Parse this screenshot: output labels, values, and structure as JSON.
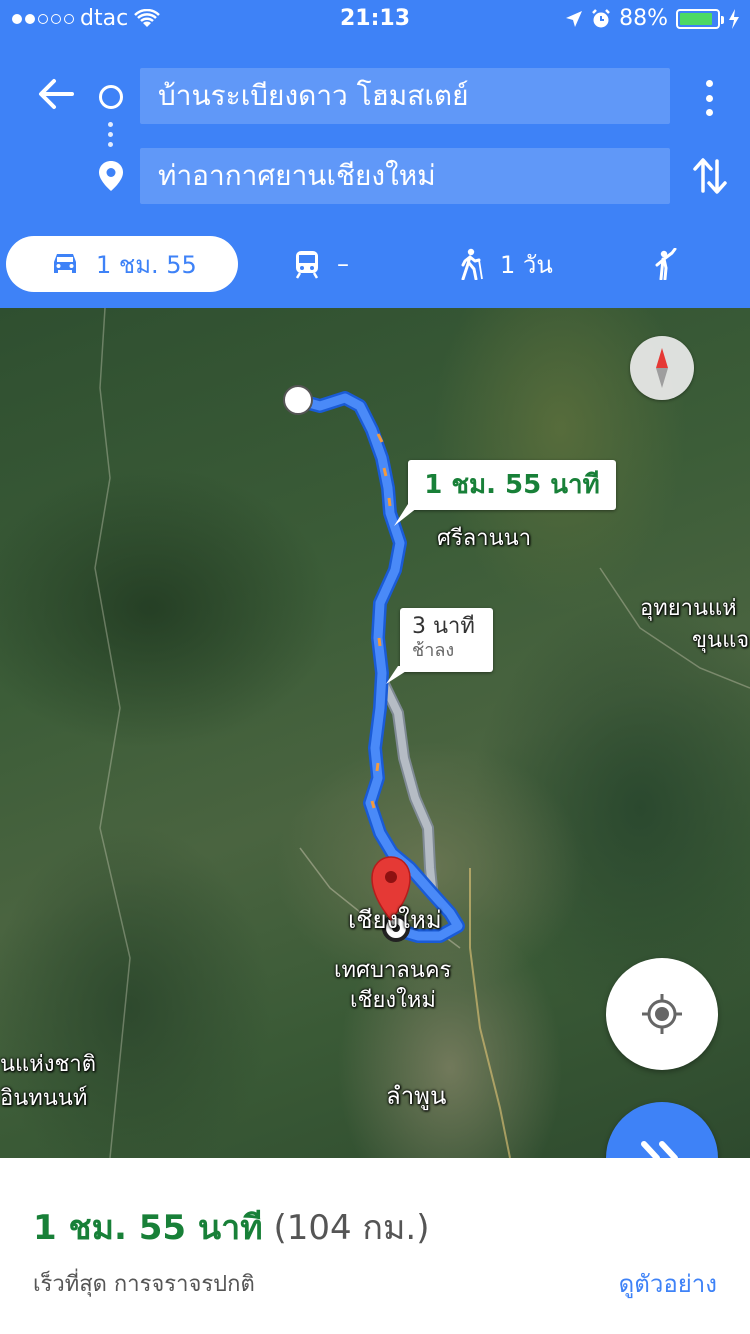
{
  "status_bar": {
    "carrier": "dtac",
    "time": "21:13",
    "battery": "88%",
    "battery_level": 0.88,
    "signal_bars_filled": 2,
    "signal_bars_total": 5
  },
  "directions": {
    "origin": "บ้านระเบียงดาว โฮมสเตย์",
    "destination": "ท่าอากาศยานเชียงใหม่"
  },
  "modes": [
    {
      "name": "car",
      "icon": "car-icon",
      "label": "1 ชม. 55",
      "active": true
    },
    {
      "name": "transit",
      "icon": "train-icon",
      "label": "–",
      "active": false
    },
    {
      "name": "walk",
      "icon": "walking-icon",
      "label": "1 วัน",
      "active": false
    },
    {
      "name": "ride",
      "icon": "hail-icon",
      "label": "",
      "active": false
    }
  ],
  "map": {
    "route_callout": "1 ชม. 55 นาที",
    "alt_callout": {
      "time": "3 นาที",
      "note": "ช้าลง"
    },
    "labels": {
      "sri_lanna": "ศรีลานนา",
      "park_1": "อุทยานแห่",
      "park_2": "ขุนแจ",
      "chiang_mai": "เชียงใหม่",
      "muni_1": "เทศบาลนคร",
      "muni_2": "เชียงใหม่",
      "np_1": "นแห่งชาติ",
      "np_2": "อินทนนท์",
      "lamphun": "ลำพูน"
    },
    "route_color": "#3e82f7",
    "alt_route_color": "#b5bcc4",
    "pin_color": "#e53935"
  },
  "summary": {
    "duration": "1 ชม. 55 นาที",
    "distance": "(104 กม.)",
    "subtitle": "เร็วที่สุด การจราจรปกติ",
    "preview_link": "ดูตัวอย่าง"
  }
}
